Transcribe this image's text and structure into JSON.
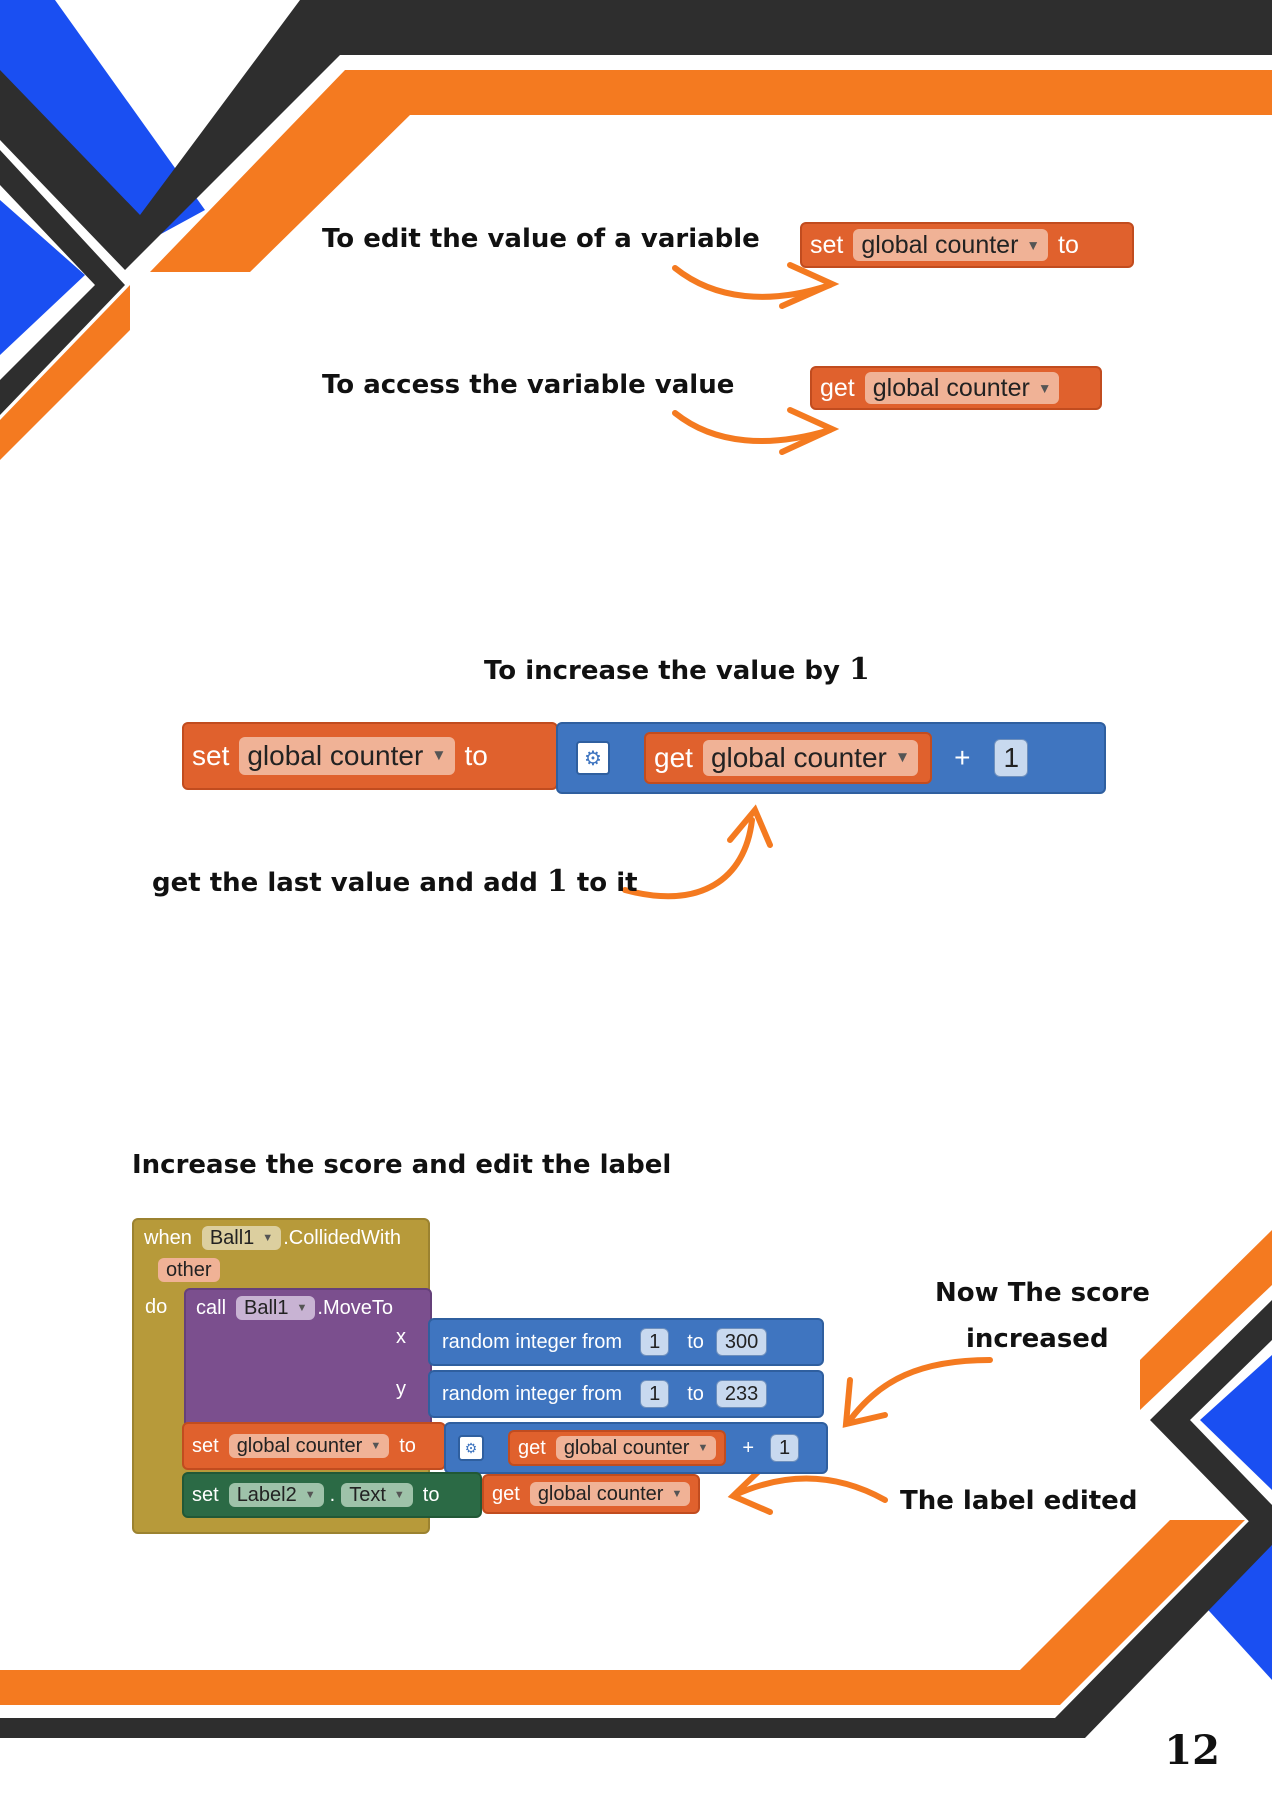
{
  "captions": {
    "edit_value": "To edit the value of a variable",
    "access_value": "To access the variable value",
    "increase_by_text": "To increase the value by",
    "increase_by_number": "1",
    "last_value_prefix": "get the last value and add",
    "last_value_number": "1",
    "last_value_suffix": "to it",
    "increase_score": "Increase the score and edit the label",
    "score_increased_line1": "Now The score",
    "score_increased_line2": "increased",
    "label_edited": "The label edited"
  },
  "blocks": {
    "set_kw": "set",
    "to_kw": "to",
    "get_kw": "get",
    "variable": "global counter",
    "plus": "+",
    "one": "1",
    "when_kw": "when",
    "ball": "Ball1",
    "collided": ".CollidedWith",
    "other": "other",
    "do_kw": "do",
    "call_kw": "call",
    "moveto": ".MoveTo",
    "x_kw": "x",
    "y_kw": "y",
    "random_from": "random integer from",
    "x_max": "300",
    "y_max": "233",
    "label": "Label2",
    "dot": ".",
    "text_prop": "Text"
  },
  "page_number": "12",
  "colors": {
    "orange": "#f47a20",
    "blue": "#1a4ff2",
    "dark": "#2e2e2e",
    "block_orange": "#e0612d",
    "block_blue": "#3f75c0",
    "block_purple": "#7b4f8e",
    "block_olive": "#b79a3a",
    "block_green": "#2b6a45"
  }
}
